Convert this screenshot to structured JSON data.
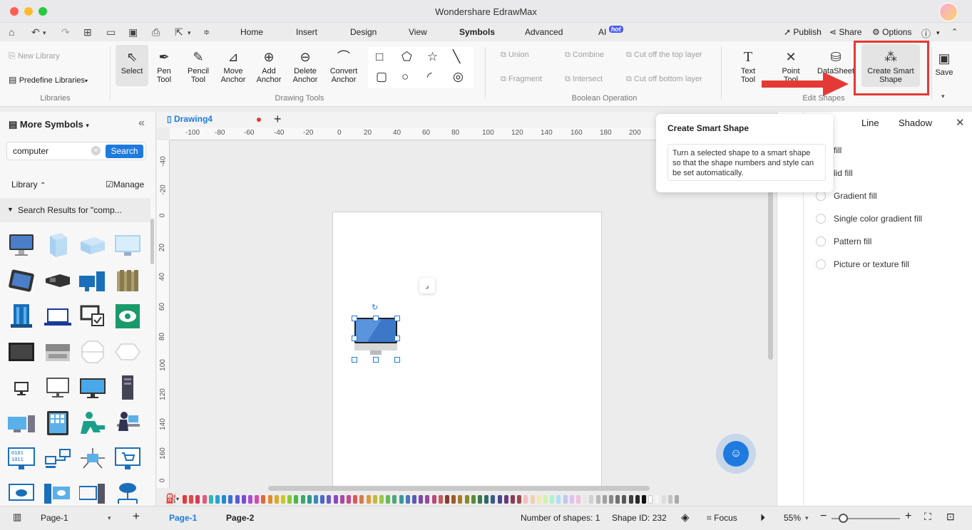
{
  "window": {
    "title": "Wondershare EdrawMax"
  },
  "menu": {
    "tabs": [
      "Home",
      "Insert",
      "Design",
      "View",
      "Symbols",
      "Advanced",
      "AI"
    ],
    "hot_badge": "hot",
    "publish": "Publish",
    "share": "Share",
    "options": "Options"
  },
  "ribbon": {
    "new_library": "New Library",
    "predefine_libraries": "Predefine Libraries",
    "libraries_label": "Libraries",
    "select": "Select",
    "pen_tool": [
      "Pen",
      "Tool"
    ],
    "pencil_tool": [
      "Pencil",
      "Tool"
    ],
    "move_anchor": [
      "Move",
      "Anchor"
    ],
    "add_anchor": [
      "Add",
      "Anchor"
    ],
    "delete_anchor": [
      "Delete",
      "Anchor"
    ],
    "convert_anchor": [
      "Convert",
      "Anchor"
    ],
    "drawing_tools_label": "Drawing Tools",
    "union": "Union",
    "combine": "Combine",
    "cut_top": "Cut off the top layer",
    "fragment": "Fragment",
    "intersect": "Intersect",
    "cut_bottom": "Cut off bottom layer",
    "boolean_label": "Boolean Operation",
    "text_tool": [
      "Text",
      "Tool"
    ],
    "point_tool": [
      "Point",
      "Tool"
    ],
    "datasheet": "DataSheet",
    "create_smart_shape": [
      "Create Smart",
      "Shape"
    ],
    "edit_shapes_label": "Edit Shapes",
    "save": "Save"
  },
  "left_panel": {
    "title": "More Symbols",
    "search_value": "computer",
    "search_button": "Search",
    "library": "Library",
    "manage": "Manage",
    "results": "Search Results for \"comp..."
  },
  "document": {
    "tab": "Drawing4",
    "hruler": [
      "-100",
      "-80",
      "-60",
      "-40",
      "-20",
      "0",
      "20",
      "40",
      "60",
      "80",
      "100",
      "120",
      "140",
      "160",
      "180",
      "200"
    ],
    "vruler": [
      "-40",
      "-20",
      "0",
      "20",
      "40",
      "60",
      "80",
      "100",
      "120",
      "140",
      "160",
      "0"
    ]
  },
  "tooltip": {
    "title": "Create Smart Shape",
    "body": "Turn a selected shape to a smart shape so that the shape numbers and style can be set automatically."
  },
  "right_panel": {
    "tabs": [
      "Line",
      "Shadow"
    ],
    "options": [
      "fill",
      "lid fill",
      "Gradient fill",
      "Single color gradient fill",
      "Pattern fill",
      "Picture or texture fill"
    ]
  },
  "status": {
    "page_select": "Page-1",
    "pages": [
      "Page-1",
      "Page-2"
    ],
    "shape_count": "Number of shapes: 1",
    "shape_id": "Shape ID: 232",
    "focus": "Focus",
    "zoom": "55%"
  },
  "colors": {
    "accent": "#1f7ae0",
    "highlight": "#e53935",
    "palette": [
      "#e63a3a",
      "#e04848",
      "#d63b5a",
      "#e05a7a",
      "#2eb8b8",
      "#2a9fd6",
      "#1e8bd6",
      "#3a6fd8",
      "#5a5ad8",
      "#7a4ad6",
      "#b04ad6",
      "#d64ab0",
      "#e06a3a",
      "#e08a2a",
      "#e0a82a",
      "#c8c82a",
      "#8ac83a",
      "#4ab84a",
      "#3aa86a",
      "#2a9a8a",
      "#3a8ab8",
      "#4a6ac8",
      "#6a5ac8",
      "#8a4ab8",
      "#a84aa8",
      "#c84a8a",
      "#d85a5a",
      "#d87a4a",
      "#d89a3a",
      "#c8b83a",
      "#9ac84a",
      "#6ab85a",
      "#4aa87a",
      "#3a989a",
      "#4a7ab8",
      "#5a5ab8",
      "#7a4aa8",
      "#984a98",
      "#b84a7a",
      "#c85a5a",
      "#8a3a2a",
      "#9a5a2a",
      "#aa7a2a",
      "#8a8a2a",
      "#5a8a3a",
      "#3a7a4a",
      "#2a6a6a",
      "#3a5a8a",
      "#4a4a8a",
      "#6a3a7a",
      "#8a3a5a",
      "#9a4a4a",
      "#f0c0c0",
      "#f0d0b0",
      "#f0e8b0",
      "#d0f0b0",
      "#b0f0d0",
      "#b0e0f0",
      "#c0c8f0",
      "#e0c0f0",
      "#f0c0e0",
      "#e8e8e8",
      "#d0d0d0",
      "#b8b8b8",
      "#a0a0a0",
      "#888888",
      "#707070",
      "#585858",
      "#404040",
      "#282828",
      "#101010",
      "#ffffff",
      "#f4f4f4",
      "#dddddd",
      "#c4c4c4",
      "#aaaaaa"
    ]
  }
}
